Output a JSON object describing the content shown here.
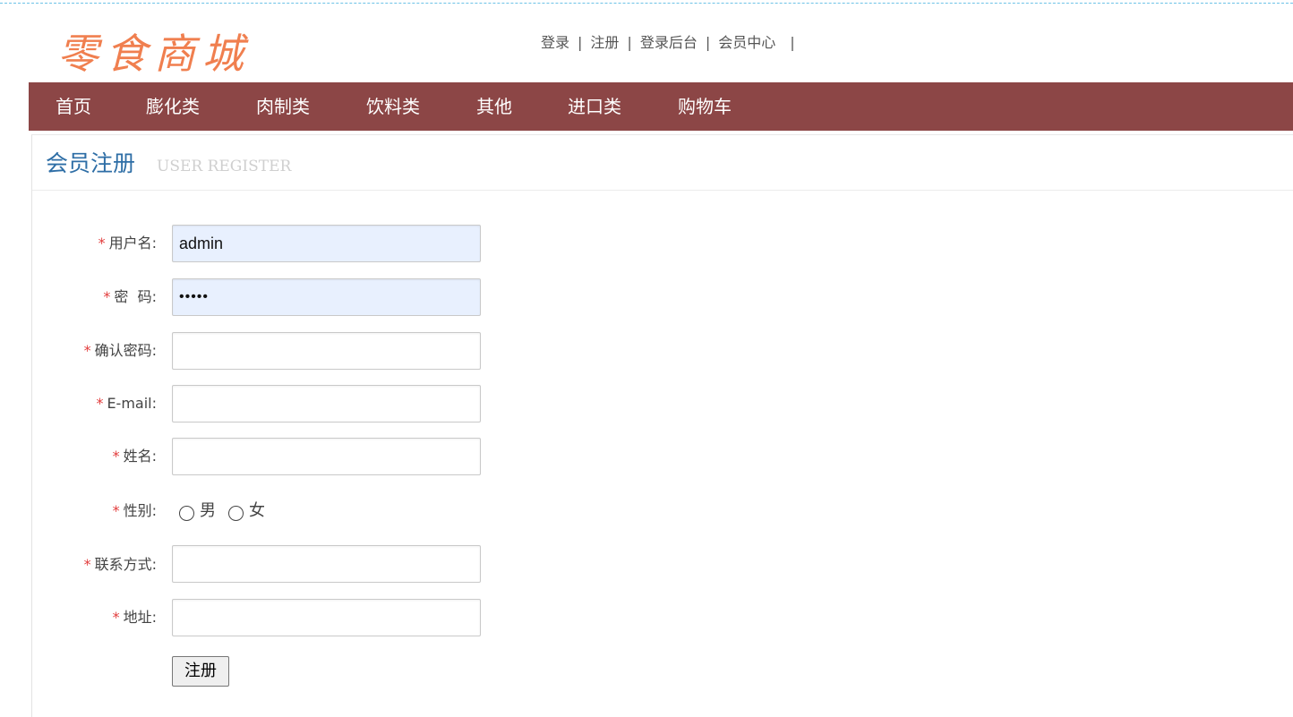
{
  "logo": {
    "text": "零食商城"
  },
  "toplinks": [
    {
      "label": "登录"
    },
    {
      "label": "注册"
    },
    {
      "label": "登录后台"
    },
    {
      "label": "会员中心"
    }
  ],
  "toplinks_separator": "|",
  "nav": [
    {
      "label": "首页"
    },
    {
      "label": "膨化类"
    },
    {
      "label": "肉制类"
    },
    {
      "label": "饮料类"
    },
    {
      "label": "其他"
    },
    {
      "label": "进口类"
    },
    {
      "label": "购物车"
    }
  ],
  "panel": {
    "title": "会员注册",
    "subtitle": "USER REGISTER"
  },
  "form": {
    "required_mark": "*",
    "username": {
      "label": "用户名:",
      "value": "admin"
    },
    "password": {
      "label": "密  码:",
      "value": "•••••"
    },
    "confirm_password": {
      "label": "确认密码:",
      "value": ""
    },
    "email": {
      "label": "E-mail:",
      "value": ""
    },
    "name": {
      "label": "姓名:",
      "value": ""
    },
    "gender": {
      "label": "性别:",
      "options": [
        "男",
        "女"
      ],
      "selected": null
    },
    "phone": {
      "label": "联系方式:",
      "value": ""
    },
    "address": {
      "label": "地址:",
      "value": ""
    },
    "submit_label": "注册"
  },
  "colors": {
    "nav_bg": "#8c4646",
    "logo": "#f07f4f",
    "title": "#2e6ea6",
    "required": "#e23c3c",
    "autofill_bg": "#e8f0fe"
  }
}
